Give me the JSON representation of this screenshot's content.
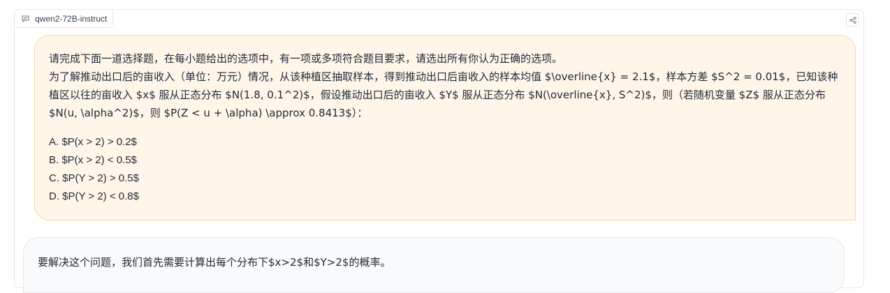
{
  "model": {
    "label": "qwen2-72B-instruct",
    "icon": "chat-icon"
  },
  "share": {
    "icon": "share-icon"
  },
  "user_message": {
    "line1": "请完成下面一道选择题，在每小题给出的选项中，有一项或多项符合题目要求，请选出所有你认为正确的选项。",
    "line2": "为了解推动出口后的亩收入（单位：万元）情况，从该种植区抽取样本，得到推动出口后亩收入的样本均值 $\\overline{x} = 2.1$，样本方差 $S^2 = 0.01$，已知该种植区以往的亩收入 $x$ 服从正态分布 $N(1.8, 0.1^2)$，假设推动出口后的亩收入 $Y$ 服从正态分布 $N(\\overline{x}, S^2)$，则（若随机变量 $Z$ 服从正态分布 $N(u, \\alpha^2)$，则 $P(Z < u + \\alpha) \\approx 0.8413$）：",
    "options": [
      "A. $P(x > 2) > 0.2$",
      "B. $P(x > 2) < 0.5$",
      "C. $P(Y > 2) > 0.5$",
      "D. $P(Y > 2) < 0.8$"
    ]
  },
  "assistant_message": {
    "text": "要解决这个问题，我们首先需要计算出每个分布下$x>2$和$Y>2$的概率。"
  },
  "colors": {
    "user_bubble_bg": "#fff5e8",
    "user_bubble_border": "#fbd5a5",
    "bot_bubble_bg": "#f9fafb"
  }
}
